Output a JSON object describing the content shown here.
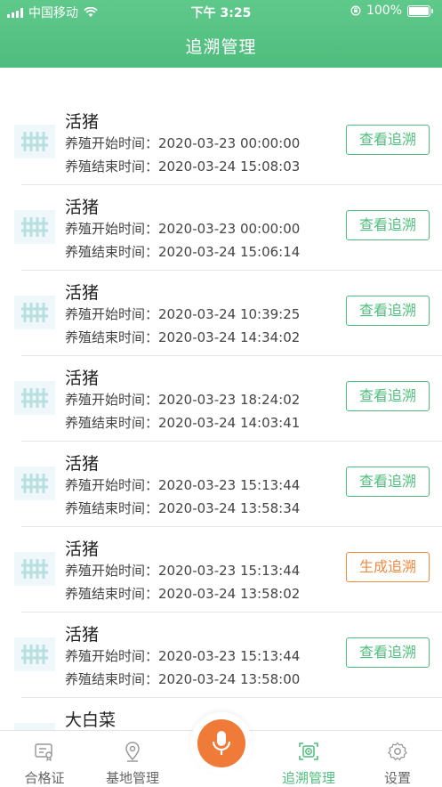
{
  "status_bar": {
    "carrier": "中国移动",
    "time": "下午 3:25",
    "battery": "100%",
    "wifi_icon": "wifi-icon",
    "orientation_lock_icon": "orientation-lock-icon"
  },
  "header": {
    "title": "追溯管理"
  },
  "records": [
    {
      "name": "活猪",
      "start_label": "养殖开始时间：",
      "start": "2020-03-23 00:00:00",
      "end_label": "养殖结束时间：",
      "end": "2020-03-24 15:08:03",
      "action": "查看追溯",
      "action_type": "view"
    },
    {
      "name": "活猪",
      "start_label": "养殖开始时间：",
      "start": "2020-03-23 00:00:00",
      "end_label": "养殖结束时间：",
      "end": "2020-03-24 15:06:14",
      "action": "查看追溯",
      "action_type": "view"
    },
    {
      "name": "活猪",
      "start_label": "养殖开始时间：",
      "start": "2020-03-24 10:39:25",
      "end_label": "养殖结束时间：",
      "end": "2020-03-24 14:34:02",
      "action": "查看追溯",
      "action_type": "view"
    },
    {
      "name": "活猪",
      "start_label": "养殖开始时间：",
      "start": "2020-03-23 18:24:02",
      "end_label": "养殖结束时间：",
      "end": "2020-03-24 14:03:41",
      "action": "查看追溯",
      "action_type": "view"
    },
    {
      "name": "活猪",
      "start_label": "养殖开始时间：",
      "start": "2020-03-23 15:13:44",
      "end_label": "养殖结束时间：",
      "end": "2020-03-24 13:58:34",
      "action": "查看追溯",
      "action_type": "view"
    },
    {
      "name": "活猪",
      "start_label": "养殖开始时间：",
      "start": "2020-03-23 15:13:44",
      "end_label": "养殖结束时间：",
      "end": "2020-03-24 13:58:02",
      "action": "生成追溯",
      "action_type": "generate"
    },
    {
      "name": "活猪",
      "start_label": "养殖开始时间：",
      "start": "2020-03-23 15:13:44",
      "end_label": "养殖结束时间：",
      "end": "2020-03-24 13:58:00",
      "action": "查看追溯",
      "action_type": "view"
    },
    {
      "name": "大白菜",
      "start_label": "",
      "start": "",
      "end_label": "",
      "end": "",
      "action": "",
      "action_type": "view"
    }
  ],
  "tabs": [
    {
      "label": "合格证",
      "icon": "certificate-icon",
      "active": false
    },
    {
      "label": "基地管理",
      "icon": "location-pin-icon",
      "active": false
    },
    {
      "label": "追溯管理",
      "icon": "trace-scan-icon",
      "active": true
    },
    {
      "label": "设置",
      "icon": "gear-icon",
      "active": false
    }
  ],
  "mic": {
    "icon": "microphone-icon"
  },
  "colors": {
    "brand_green": "#4fbe7e",
    "accent_orange": "#f07a37",
    "button_orange": "#f08a3c"
  }
}
